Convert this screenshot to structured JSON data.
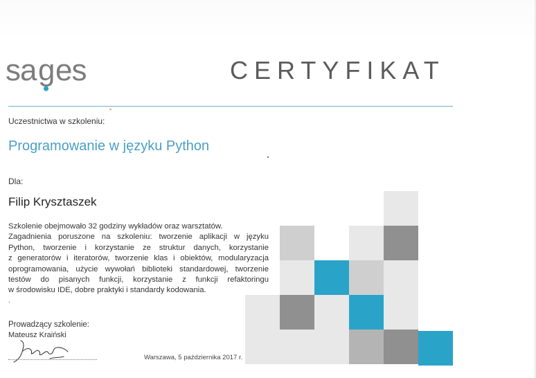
{
  "header": {
    "brand": "sages",
    "title": "CERTYFIKAT"
  },
  "participation_label": "Uczestnictwa w szkoleniu:",
  "course_title": "Programowanie w języku Python",
  "recipient_label": "Dla:",
  "recipient_name": "Filip Krysztaszek",
  "description": {
    "lines": [
      "Szkolenie obejmowało 32 godziny wykładów oraz warsztatów.",
      "Zagadnienia poruszone na szkoleniu: tworzenie aplikacji w języku",
      "Python, tworzenie i korzystanie ze struktur danych, korzystanie",
      "z generatorów i iteratorów, tworzenie klas i obiektów, modularyzacja",
      "oprogramowania, użycie wywołań biblioteki standardowej, tworzenie",
      "testów do pisanych funkcji, korzystanie z funkcji refaktoringu",
      "w środowisku IDE, dobre praktyki i standardy kodowania."
    ],
    "extra": "."
  },
  "instructor": {
    "label": "Prowadzący szkolenie:",
    "name": "Mateusz Kraiński"
  },
  "place_date": "Warszawa, 5 października 2017 r.",
  "colors": {
    "brand_gray": "#7d7d7d",
    "accent_blue": "#2aa3c9",
    "course_blue": "#4a9fc7",
    "rule_blue": "#6fb0cf",
    "mosaic_dark_gray": "#909090",
    "mosaic_mid_gray": "#b4b4b4",
    "mosaic_light_gray": "#cfcfcf",
    "mosaic_pale_gray": "#e8e8e8"
  },
  "mosaic_tiles": [
    {
      "tone": "pale"
    },
    {
      "tone": "light"
    },
    {
      "tone": "pale"
    },
    {
      "tone": "dark"
    },
    {
      "tone": "pale"
    },
    {
      "tone": "blue"
    },
    {
      "tone": "light"
    },
    {
      "tone": "pale"
    },
    {
      "tone": "pale"
    },
    {
      "tone": "dark"
    },
    {
      "tone": "pale"
    },
    {
      "tone": "blue"
    },
    {
      "tone": "pale"
    },
    {
      "tone": "pale"
    },
    {
      "tone": "pale"
    },
    {
      "tone": "mid"
    },
    {
      "tone": "dark"
    },
    {
      "tone": "pale"
    },
    {
      "tone": "blue"
    }
  ]
}
